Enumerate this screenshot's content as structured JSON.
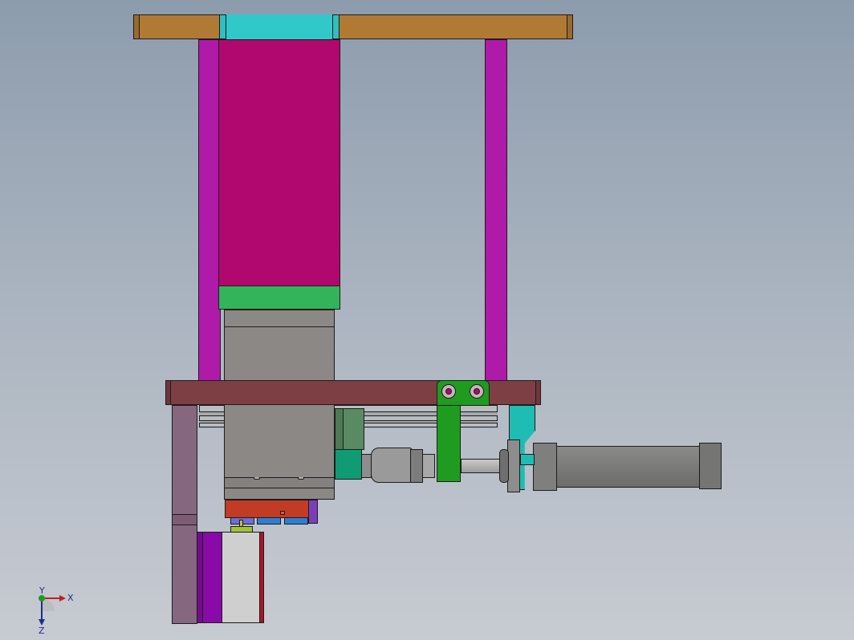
{
  "app": {
    "title": "",
    "colors": {
      "top_plate": "#b07a35",
      "top_collar": "#2fbec1",
      "guide_rods": "#b01aa8",
      "motor_body": "#b0086e",
      "motor_flange": "#33b45a",
      "gearbox": "#8c8886",
      "base_plate": "#7e3f44",
      "side_post": "#866780",
      "bracket_green": "#1f9c1f",
      "cylinder": "#7a7a78",
      "bracket_cyan": "#1fbcb3",
      "red_block": "#c23b25",
      "blue_blocks": "#2d7fd2",
      "purple_block": "#8a0aa8",
      "white_block": "#cfcfcf",
      "dark_green_block": "#5a8a62",
      "teal_block": "#0f9b73"
    }
  },
  "triad": {
    "x_label": "X",
    "y_label": "Y",
    "z_label": "Z",
    "icon": "coordinate-triad-icon"
  }
}
